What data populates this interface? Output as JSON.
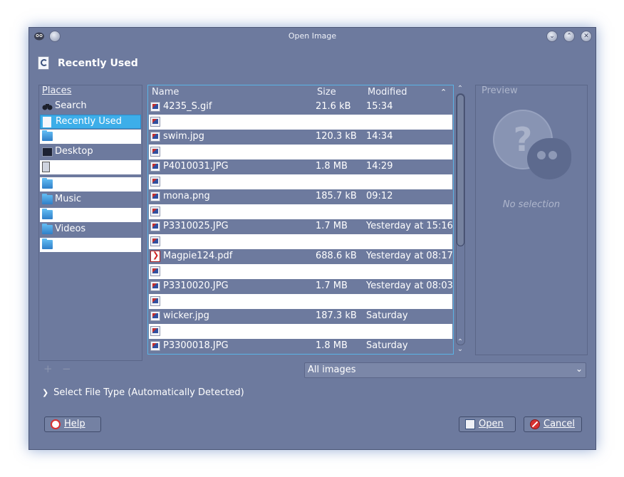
{
  "window": {
    "title": "Open Image",
    "title_buttons": [
      "minimize-icon",
      "maximize-icon",
      "close-icon"
    ]
  },
  "location": {
    "label": "Recently Used",
    "icon": "recent-document-icon"
  },
  "places": {
    "header": "Places",
    "items": [
      {
        "label": "Search",
        "icon": "binoculars-icon"
      },
      {
        "label": "Recently Used",
        "icon": "recent-document-icon",
        "selected": true
      },
      {
        "label": "",
        "icon": "home-folder-icon"
      },
      {
        "label": "Desktop",
        "icon": "desktop-icon"
      },
      {
        "label": "",
        "icon": "drive-icon"
      },
      {
        "label": "",
        "icon": "folder-icon"
      },
      {
        "label": "Music",
        "icon": "folder-icon"
      },
      {
        "label": "",
        "icon": "folder-icon"
      },
      {
        "label": "Videos",
        "icon": "folder-icon"
      },
      {
        "label": "",
        "icon": "folder-icon"
      }
    ]
  },
  "files": {
    "headers": {
      "name": "Name",
      "size": "Size",
      "modified": "Modified"
    },
    "sort_icon": "chevron-up-icon",
    "rows": [
      {
        "name": "4235_S.gif",
        "size": "21.6 kB",
        "modified": "15:34",
        "icon": "image-file-icon"
      },
      {
        "name": "",
        "size": "",
        "modified": "",
        "icon": "image-file-icon"
      },
      {
        "name": "swim.jpg",
        "size": "120.3 kB",
        "modified": "14:34",
        "icon": "image-file-icon"
      },
      {
        "name": "",
        "size": "",
        "modified": "",
        "icon": "image-file-icon"
      },
      {
        "name": "P4010031.JPG",
        "size": "1.8 MB",
        "modified": "14:29",
        "icon": "image-file-icon"
      },
      {
        "name": "",
        "size": "",
        "modified": "",
        "icon": "image-file-icon"
      },
      {
        "name": "mona.png",
        "size": "185.7 kB",
        "modified": "09:12",
        "icon": "image-file-icon"
      },
      {
        "name": "",
        "size": "",
        "modified": "",
        "icon": "image-file-icon"
      },
      {
        "name": "P3310025.JPG",
        "size": "1.7 MB",
        "modified": "Yesterday at 15:16",
        "icon": "image-file-icon"
      },
      {
        "name": "",
        "size": "",
        "modified": "",
        "icon": "image-file-icon"
      },
      {
        "name": "Magpie124.pdf",
        "size": "688.6 kB",
        "modified": "Yesterday at 08:17",
        "icon": "pdf-file-icon"
      },
      {
        "name": "",
        "size": "",
        "modified": "",
        "icon": "image-file-icon"
      },
      {
        "name": "P3310020.JPG",
        "size": "1.7 MB",
        "modified": "Yesterday at 08:03",
        "icon": "image-file-icon"
      },
      {
        "name": "",
        "size": "",
        "modified": "",
        "icon": "image-file-icon"
      },
      {
        "name": "wicker.jpg",
        "size": "187.3 kB",
        "modified": "Saturday",
        "icon": "image-file-icon"
      },
      {
        "name": "",
        "size": "",
        "modified": "",
        "icon": "image-file-icon"
      },
      {
        "name": "P3300018.JPG",
        "size": "1.8 MB",
        "modified": "Saturday",
        "icon": "image-file-icon"
      }
    ]
  },
  "preview": {
    "header": "Preview",
    "empty_text": "No selection"
  },
  "places_buttons": {
    "add_icon": "add-icon",
    "remove_icon": "remove-icon"
  },
  "filter": {
    "selected": "All images"
  },
  "file_type_expander": {
    "label": "Select File Type (Automatically Detected)"
  },
  "buttons": {
    "help": "Help",
    "open": "Open",
    "cancel": "Cancel"
  },
  "colors": {
    "window_bg": "#6d7a9e",
    "selection": "#3daee9",
    "alt_row": "#ffffff"
  }
}
